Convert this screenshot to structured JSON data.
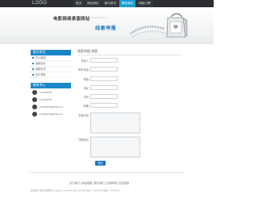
{
  "header": {
    "logo": "LOGO",
    "nav": [
      "首页",
      "网站首页",
      "影讯资讯",
      "联系我们",
      "网络订票"
    ]
  },
  "banner": {
    "title": "电影网络承版网站",
    "subtitle": "Cinema Movie",
    "slogan": "线索举报",
    "box_icon": "shopping-bag-icon"
  },
  "sidebar": {
    "menu_title": "影讯资讯",
    "menu_items": [
      "中心新闻",
      "最新影片",
      "最新影讯",
      "影片预告"
    ],
    "contact_title": "联系中心",
    "contacts": [
      "123456789",
      "123456789",
      "123456789@163.com",
      "123456789@163.com"
    ]
  },
  "form": {
    "title": "线索举报  线索",
    "fields": [
      "举报人",
      "联系电话",
      "邮箱",
      "地址",
      "手机",
      "邮编",
      "QQ"
    ],
    "textareas": [
      "举报内容",
      "详细信息"
    ],
    "submit_label": "提交"
  },
  "footer": {
    "links": "关于我们 | 网站地图 | 联系我们 | 法律声明 | 友情链接",
    "copyright": "版权所有 网络承版网站  Copyright © 2014  All rights reserved  地址：XXXXXXX  电话：XXXXXXX"
  }
}
